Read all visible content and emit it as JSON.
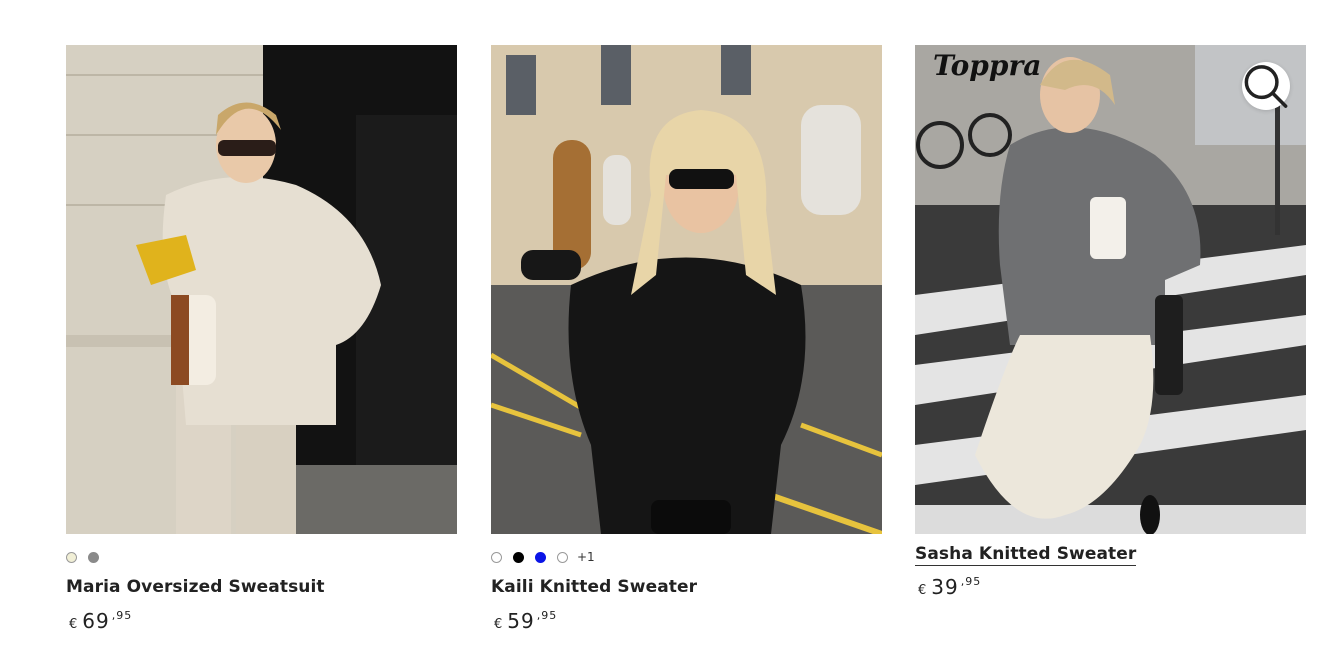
{
  "products": [
    {
      "name": "Maria Oversized Sweatsuit",
      "currency": "€",
      "price_main": "69",
      "price_decimals": ",95",
      "swatches": [
        {
          "color": "#f1efd6",
          "light": true
        },
        {
          "color": "#8a8a8a",
          "light": false
        }
      ]
    },
    {
      "name": "Kaili Knitted Sweater",
      "currency": "€",
      "price_main": "59",
      "price_decimals": ",95",
      "swatches": [
        {
          "color": "#ffffff",
          "light": true
        },
        {
          "color": "#000000",
          "light": false
        },
        {
          "color": "#0a14e6",
          "light": false
        },
        {
          "color": "#ffffff",
          "light": true
        }
      ],
      "more_colors": "+1"
    },
    {
      "name": "Sasha Knitted Sweater",
      "currency": "€",
      "price_main": "39",
      "price_decimals": ",95",
      "image_watermark": "Toppra"
    }
  ],
  "icons": {
    "zoom": "search-icon"
  }
}
